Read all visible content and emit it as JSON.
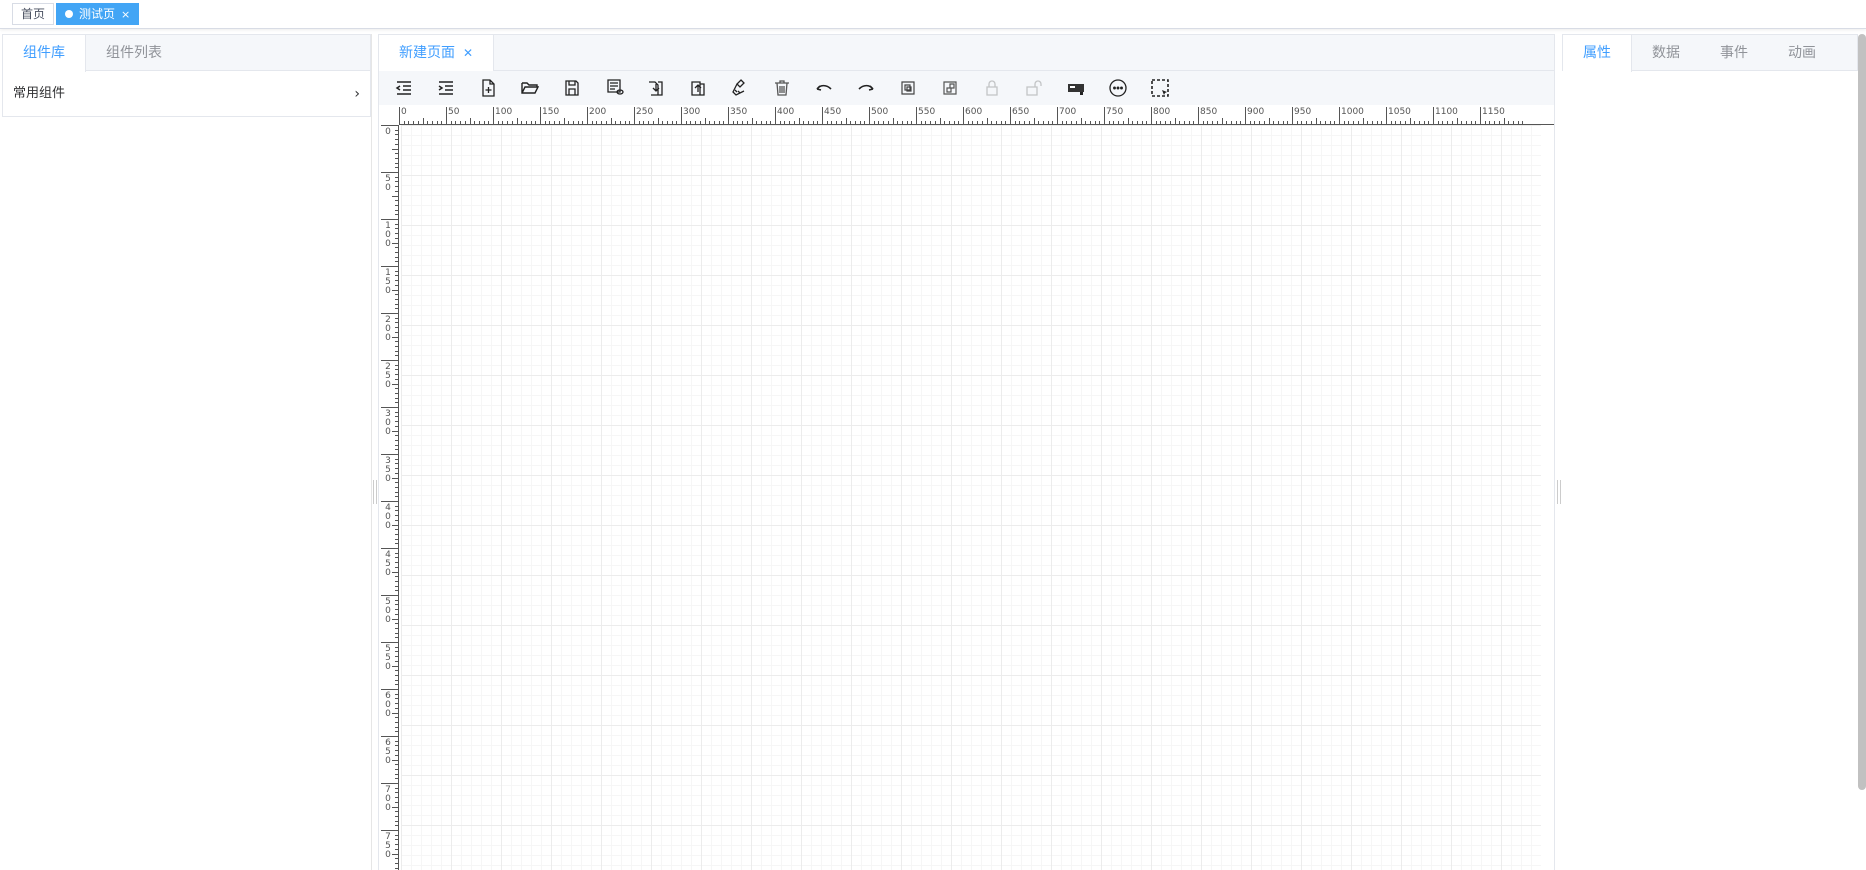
{
  "page_tabs": [
    {
      "label": "首页",
      "active": false
    },
    {
      "label": "测试页",
      "active": true,
      "close": "×"
    }
  ],
  "left": {
    "tabs": [
      "组件库",
      "组件列表"
    ],
    "active_tab": 0,
    "groups": [
      {
        "label": "常用组件",
        "chevron": "›"
      }
    ]
  },
  "center": {
    "doc_tab": {
      "label": "新建页面",
      "close": "✕"
    },
    "toolbar": [
      {
        "name": "outdent",
        "disabled": false
      },
      {
        "name": "indent",
        "disabled": false
      },
      {
        "name": "new-file",
        "disabled": false
      },
      {
        "name": "open-folder",
        "disabled": false
      },
      {
        "name": "save",
        "disabled": false
      },
      {
        "name": "preview",
        "disabled": false
      },
      {
        "name": "import",
        "disabled": false
      },
      {
        "name": "export",
        "disabled": false
      },
      {
        "name": "clear",
        "disabled": false
      },
      {
        "name": "delete",
        "disabled": false
      },
      {
        "name": "undo",
        "disabled": false
      },
      {
        "name": "redo",
        "disabled": false
      },
      {
        "name": "group",
        "disabled": false
      },
      {
        "name": "ungroup",
        "disabled": false
      },
      {
        "name": "lock",
        "disabled": true
      },
      {
        "name": "unlock",
        "disabled": true
      },
      {
        "name": "screenshot",
        "disabled": false
      },
      {
        "name": "more",
        "disabled": false
      },
      {
        "name": "select-area",
        "disabled": false
      }
    ],
    "ruler_h": [
      "0",
      "50",
      "100",
      "150",
      "200",
      "250",
      "300",
      "350",
      "400",
      "450",
      "500",
      "550",
      "600",
      "650",
      "700",
      "750",
      "800",
      "850",
      "900",
      "950",
      "1000",
      "1050",
      "1100",
      "1150"
    ],
    "ruler_v": [
      "0",
      "50",
      "100",
      "150",
      "200",
      "250",
      "300",
      "350",
      "400",
      "450",
      "500",
      "550",
      "600",
      "650",
      "700",
      "750"
    ]
  },
  "right": {
    "tabs": [
      "属性",
      "数据",
      "事件",
      "动画"
    ],
    "active_tab": 0
  }
}
